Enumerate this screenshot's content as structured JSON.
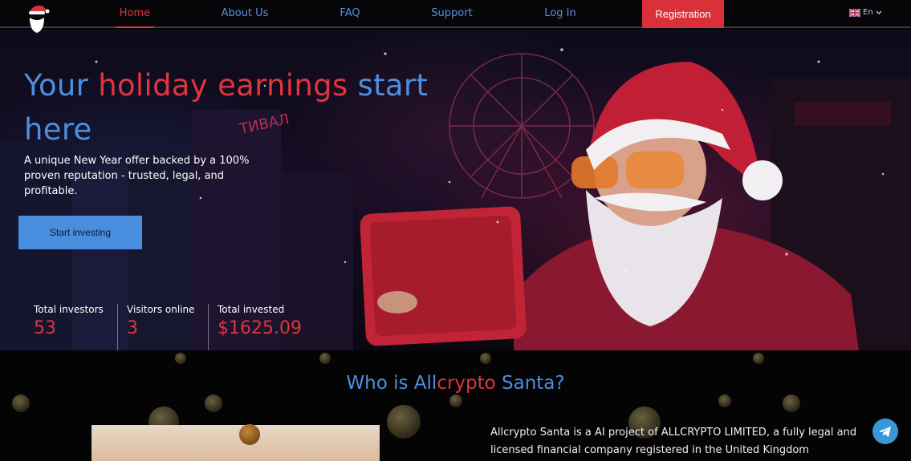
{
  "nav": {
    "links": [
      "Home",
      "About Us",
      "FAQ",
      "Support",
      "Log In"
    ],
    "registration": "Registration",
    "language": "En"
  },
  "hero": {
    "title_part1": "Your ",
    "title_part2": "holiday earnings",
    "title_part3": " start here",
    "subtitle": "A unique New Year offer backed by a 100% proven reputation - trusted, legal, and profitable.",
    "cta": "Start investing"
  },
  "stats": [
    {
      "label": "Total investors",
      "value": "53"
    },
    {
      "label": "Visitors online",
      "value": "3"
    },
    {
      "label": "Total invested",
      "value": "$1625.09"
    }
  ],
  "who": {
    "part1": "Who is All",
    "part2": "crypto",
    "part3": " Santa?"
  },
  "about": "Allcrypto Santa is a AI project of ALLCRYPTO LIMITED, a fully legal and licensed financial company registered in the United Kingdom",
  "colors": {
    "accent_blue": "#4d8ee0",
    "accent_red": "#e0343e",
    "background": "#050507"
  },
  "icons": {
    "logo": "santa-logo-icon",
    "language": "uk-flag-icon",
    "chevron": "chevron-down-icon",
    "telegram": "telegram-icon"
  }
}
